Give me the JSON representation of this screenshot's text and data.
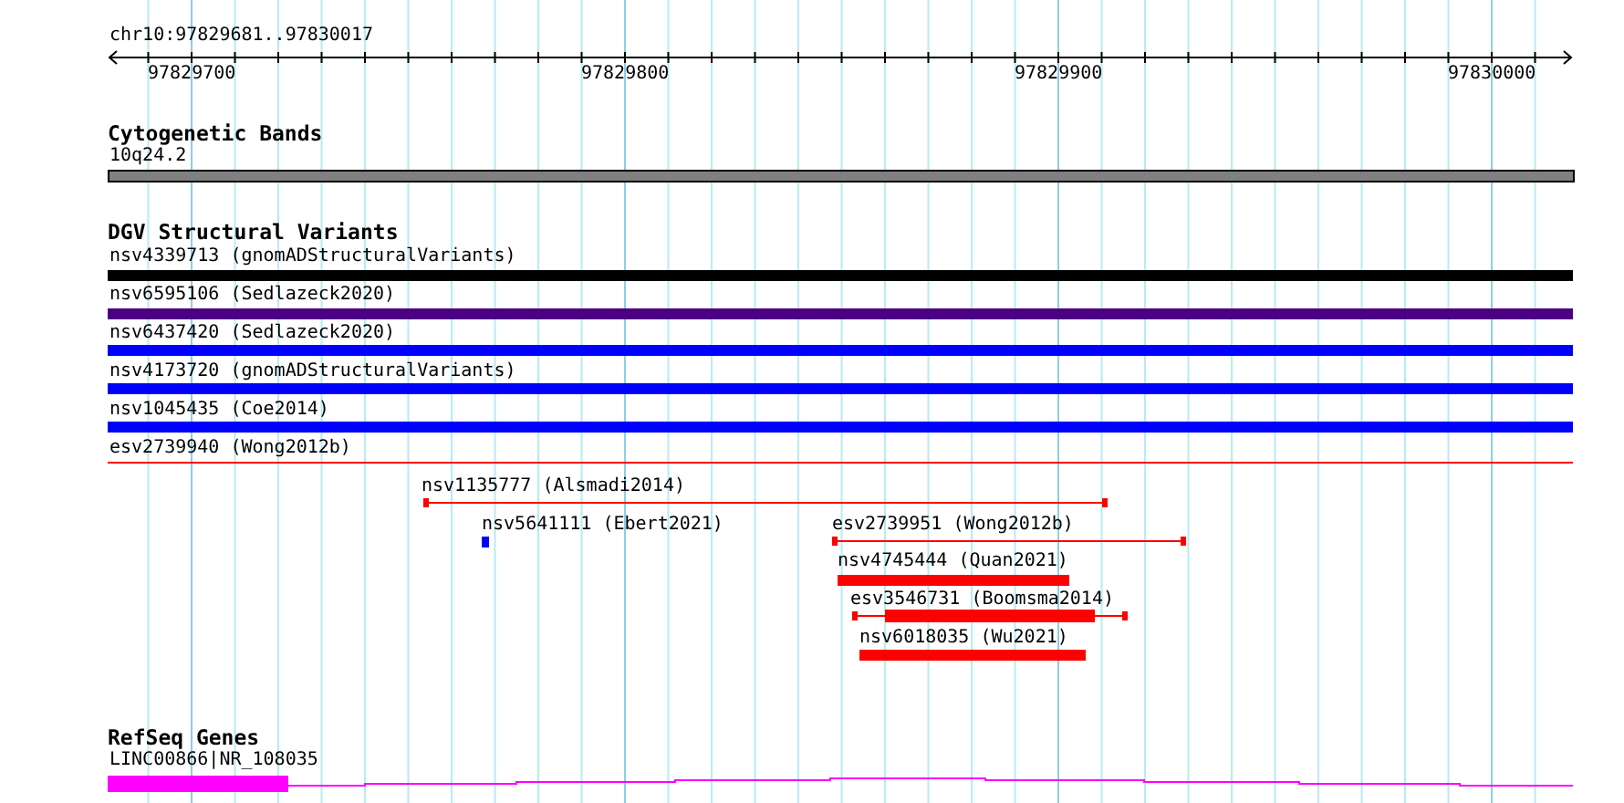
{
  "location": "chr10:97829681..97830017",
  "ruler": {
    "ticks": [
      "97829700",
      "97829800",
      "97829900",
      "97830000"
    ]
  },
  "cytogenetic": {
    "title": "Cytogenetic Bands",
    "band": {
      "label": "10q24.2"
    }
  },
  "dgv": {
    "title": "DGV Structural Variants",
    "features": [
      {
        "label": "nsv4339713 (gnomADStructuralVariants)",
        "kind": "bar",
        "color": "#000000"
      },
      {
        "label": "nsv6595106 (Sedlazeck2020)",
        "kind": "bar",
        "color": "#4b0082"
      },
      {
        "label": "nsv6437420 (Sedlazeck2020)",
        "kind": "bar",
        "color": "#0000ff"
      },
      {
        "label": "nsv4173720 (gnomADStructuralVariants)",
        "kind": "bar",
        "color": "#0000ff"
      },
      {
        "label": "nsv1045435 (Coe2014)",
        "kind": "bar",
        "color": "#0000ff"
      },
      {
        "label": "esv2739940 (Wong2012b)",
        "kind": "line",
        "color": "#ff0000"
      },
      {
        "label": "nsv1135777 (Alsmadi2014)",
        "kind": "line",
        "color": "#ff0000"
      },
      {
        "label": "nsv5641111 (Ebert2021)",
        "kind": "bar",
        "color": "#0000ff"
      },
      {
        "label": "esv2739951 (Wong2012b)",
        "kind": "line",
        "color": "#ff0000"
      },
      {
        "label": "nsv4745444 (Quan2021)",
        "kind": "bar",
        "color": "#ff0000"
      },
      {
        "label": "esv3546731 (Boomsma2014)",
        "kind": "compound",
        "color": "#ff0000"
      },
      {
        "label": "nsv6018035 (Wu2021)",
        "kind": "bar",
        "color": "#ff0000"
      }
    ]
  },
  "refseq": {
    "title": "RefSeq Genes",
    "gene": {
      "label": "LINC00866|NR_108035"
    }
  }
}
